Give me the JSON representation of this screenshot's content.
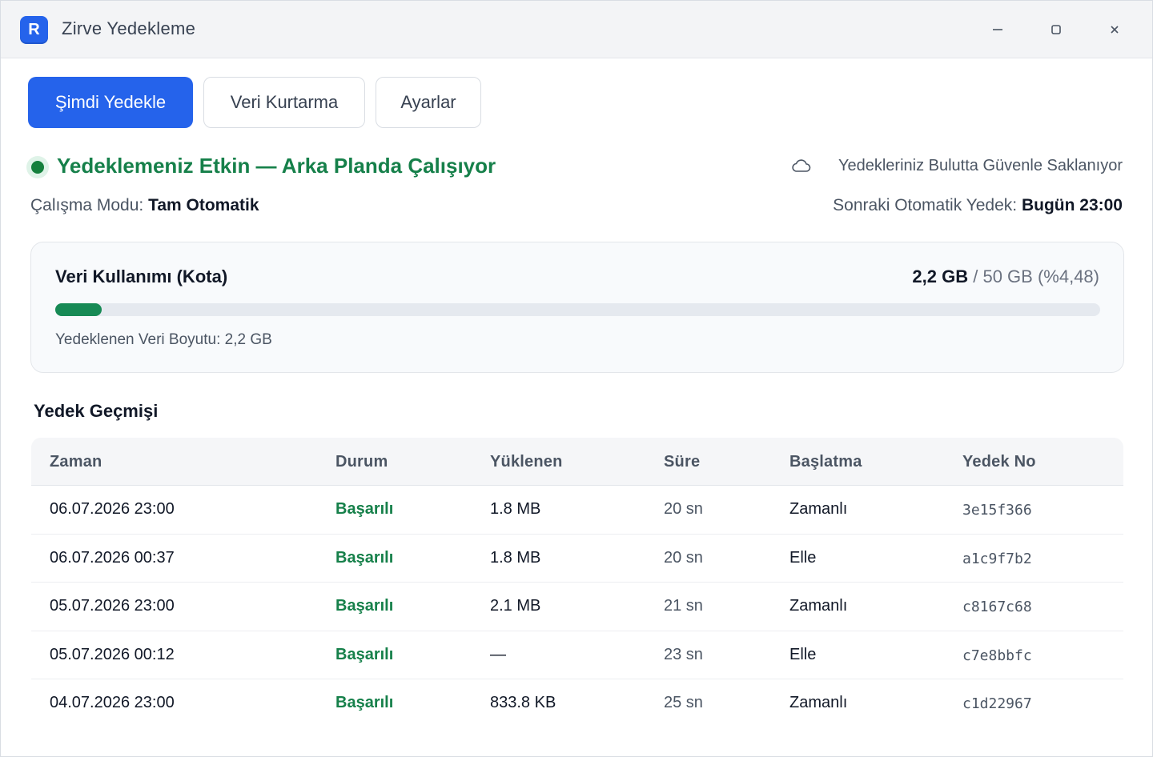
{
  "window": {
    "logo_letter": "R",
    "title": "Zirve Yedekleme"
  },
  "toolbar": {
    "backup_now": "Şimdi Yedekle",
    "recovery": "Veri Kurtarma",
    "settings": "Ayarlar"
  },
  "status": {
    "text": "Yedeklemeniz Etkin — Arka Planda Çalışıyor",
    "cloud_text": "Yedekleriniz Bulutta Güvenle Saklanıyor",
    "mode_label": "Çalışma Modu:",
    "mode_value": "Tam Otomatik",
    "next_label": "Sonraki Otomatik Yedek:",
    "next_value": "Bugün 23:00"
  },
  "quota": {
    "title": "Veri Kullanımı (Kota)",
    "used": "2,2 GB",
    "total_text": "/ 50 GB (%4,48)",
    "percent": 4.48,
    "size_text": "Yedeklenen Veri Boyutu: 2,2 GB"
  },
  "history": {
    "title": "Yedek Geçmişi",
    "columns": [
      "Zaman",
      "Durum",
      "Yüklenen",
      "Süre",
      "Başlatma",
      "Yedek No"
    ],
    "rows": [
      {
        "time": "06.07.2026 23:00",
        "status": "Başarılı",
        "uploaded": "1.8 MB",
        "duration": "20 sn",
        "trigger": "Zamanlı",
        "id": "3e15f366"
      },
      {
        "time": "06.07.2026 00:37",
        "status": "Başarılı",
        "uploaded": "1.8 MB",
        "duration": "20 sn",
        "trigger": "Elle",
        "id": "a1c9f7b2"
      },
      {
        "time": "05.07.2026 23:00",
        "status": "Başarılı",
        "uploaded": "2.1 MB",
        "duration": "21 sn",
        "trigger": "Zamanlı",
        "id": "c8167c68"
      },
      {
        "time": "05.07.2026 00:12",
        "status": "Başarılı",
        "uploaded": "—",
        "duration": "23 sn",
        "trigger": "Elle",
        "id": "c7e8bbfc"
      },
      {
        "time": "04.07.2026 23:00",
        "status": "Başarılı",
        "uploaded": "833.8 KB",
        "duration": "25 sn",
        "trigger": "Zamanlı",
        "id": "c1d22967"
      }
    ]
  },
  "colors": {
    "accent": "#2563eb",
    "success": "#16804a",
    "progress": "#178a55"
  }
}
